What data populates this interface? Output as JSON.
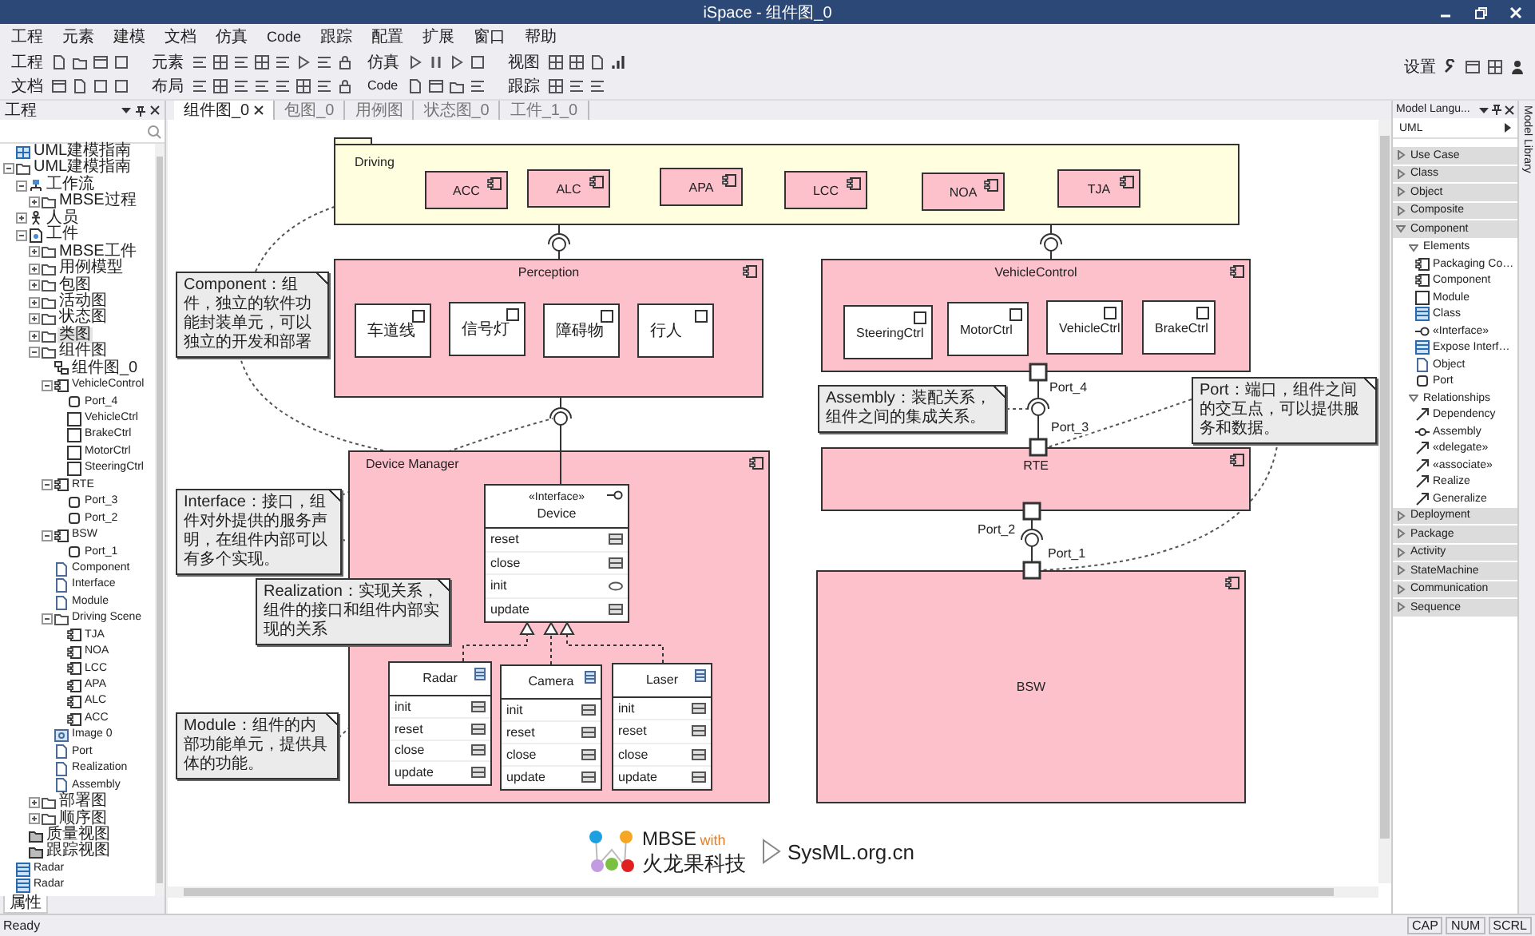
{
  "window": {
    "title": "iSpace - 组件图_0"
  },
  "menu": [
    "工程",
    "元素",
    "建模",
    "文档",
    "仿真",
    "Code",
    "跟踪",
    "配置",
    "扩展",
    "窗口",
    "帮助"
  ],
  "toolbar": {
    "columns": [
      [
        "工程",
        "文档"
      ],
      [
        "元素",
        "布局"
      ],
      [
        "仿真",
        "Code"
      ],
      [
        "视图",
        "跟踪"
      ]
    ],
    "settings": "设置"
  },
  "project_panel": {
    "title": "工程",
    "bottom_tab": "属性",
    "tree": [
      {
        "label": "UML建模指南",
        "kind": "model",
        "selected": false
      },
      {
        "label": "UML建模指南",
        "kind": "folder",
        "expanded": true,
        "selected": false,
        "children": [
          {
            "label": "工作流",
            "kind": "workflow",
            "expanded": true,
            "selected": false,
            "children": [
              {
                "label": "MBSE过程",
                "kind": "folder",
                "expanded": false,
                "selected": false
              }
            ]
          },
          {
            "label": "人员",
            "kind": "actor",
            "expanded": false,
            "selected": false
          },
          {
            "label": "工件",
            "kind": "artifact",
            "expanded": true,
            "selected": false,
            "children": [
              {
                "label": "MBSE工件",
                "kind": "folder",
                "expanded": false,
                "selected": false
              },
              {
                "label": "用例模型",
                "kind": "folder",
                "expanded": false,
                "selected": false
              },
              {
                "label": "包图",
                "kind": "folder",
                "expanded": false,
                "selected": false
              },
              {
                "label": "活动图",
                "kind": "folder",
                "expanded": false,
                "selected": false
              },
              {
                "label": "状态图",
                "kind": "folder",
                "expanded": false,
                "selected": false
              },
              {
                "label": "类图",
                "kind": "folder",
                "expanded": false,
                "selected": true
              },
              {
                "label": "组件图",
                "kind": "folder",
                "expanded": true,
                "selected": false,
                "children": [
                  {
                    "label": "组件图_0",
                    "kind": "diagram",
                    "selected": false
                  },
                  {
                    "label": "VehicleControl",
                    "kind": "component",
                    "expanded": true,
                    "selected": false,
                    "children": [
                      {
                        "label": "Port_4",
                        "kind": "port",
                        "selected": false
                      },
                      {
                        "label": "VehicleCtrl",
                        "kind": "module",
                        "selected": false
                      },
                      {
                        "label": "BrakeCtrl",
                        "kind": "module",
                        "selected": false
                      },
                      {
                        "label": "MotorCtrl",
                        "kind": "module",
                        "selected": false
                      },
                      {
                        "label": "SteeringCtrl",
                        "kind": "module",
                        "selected": false
                      }
                    ]
                  },
                  {
                    "label": "RTE",
                    "kind": "component",
                    "expanded": true,
                    "selected": false,
                    "children": [
                      {
                        "label": "Port_3",
                        "kind": "port",
                        "selected": false
                      },
                      {
                        "label": "Port_2",
                        "kind": "port",
                        "selected": false
                      }
                    ]
                  },
                  {
                    "label": "BSW",
                    "kind": "component",
                    "expanded": true,
                    "selected": false,
                    "children": [
                      {
                        "label": "Port_1",
                        "kind": "port",
                        "selected": false
                      }
                    ]
                  },
                  {
                    "label": "Component",
                    "kind": "document",
                    "selected": false
                  },
                  {
                    "label": "Interface",
                    "kind": "document",
                    "selected": false
                  },
                  {
                    "label": "Module",
                    "kind": "document",
                    "selected": false
                  },
                  {
                    "label": "Driving Scene",
                    "kind": "folder",
                    "expanded": true,
                    "selected": false,
                    "children": [
                      {
                        "label": "TJA",
                        "kind": "component",
                        "selected": false
                      },
                      {
                        "label": "NOA",
                        "kind": "component",
                        "selected": false
                      },
                      {
                        "label": "LCC",
                        "kind": "component",
                        "selected": false
                      },
                      {
                        "label": "APA",
                        "kind": "component",
                        "selected": false
                      },
                      {
                        "label": "ALC",
                        "kind": "component",
                        "selected": false
                      },
                      {
                        "label": "ACC",
                        "kind": "component",
                        "selected": false
                      }
                    ]
                  },
                  {
                    "label": "Image 0",
                    "kind": "image",
                    "selected": false
                  },
                  {
                    "label": "Port",
                    "kind": "document",
                    "selected": false
                  },
                  {
                    "label": "Realization",
                    "kind": "document",
                    "selected": false
                  },
                  {
                    "label": "Assembly",
                    "kind": "document",
                    "selected": false
                  }
                ]
              },
              {
                "label": "部署图",
                "kind": "folder",
                "expanded": false,
                "selected": false
              },
              {
                "label": "顺序图",
                "kind": "folder",
                "expanded": false,
                "selected": false
              }
            ]
          },
          {
            "label": "质量视图",
            "kind": "view",
            "selected": false
          },
          {
            "label": "跟踪视图",
            "kind": "view",
            "selected": false
          }
        ]
      },
      {
        "label": "Radar",
        "kind": "class",
        "selected": false
      },
      {
        "label": "Radar",
        "kind": "class",
        "selected": false
      }
    ]
  },
  "doc_tabs": [
    {
      "label": "组件图_0",
      "selected": true
    },
    {
      "label": "包图_0",
      "selected": false
    },
    {
      "label": "用例图",
      "selected": false
    },
    {
      "label": "状态图_0",
      "selected": false
    },
    {
      "label": "工件_1_0",
      "selected": false
    }
  ],
  "diagram": {
    "package": {
      "name": "Driving",
      "components": [
        "ACC",
        "ALC",
        "APA",
        "LCC",
        "NOA",
        "TJA"
      ]
    },
    "components": [
      {
        "name": "Perception",
        "parts": [
          "车道线",
          "信号灯",
          "障碍物",
          "行人"
        ]
      },
      {
        "name": "VehicleControl",
        "parts": [
          "SteeringCtrl",
          "MotorCtrl",
          "VehicleCtrl",
          "BrakeCtrl"
        ]
      },
      {
        "name": "Device Manager"
      },
      {
        "name": "RTE"
      },
      {
        "name": "BSW"
      }
    ],
    "interface": {
      "stereotype": "«Interface»",
      "name": "Device",
      "operations": [
        {
          "name": "reset",
          "kind": "operation"
        },
        {
          "name": "close",
          "kind": "operation"
        },
        {
          "name": "init",
          "kind": "reception"
        },
        {
          "name": "update",
          "kind": "operation"
        }
      ]
    },
    "classes": [
      {
        "name": "Radar",
        "operations": [
          "init",
          "reset",
          "close",
          "update"
        ]
      },
      {
        "name": "Camera",
        "operations": [
          "init",
          "reset",
          "close",
          "update"
        ]
      },
      {
        "name": "Laser",
        "operations": [
          "init",
          "reset",
          "close",
          "update"
        ]
      }
    ],
    "ports": [
      "Port_4",
      "Port_3",
      "Port_2",
      "Port_1"
    ],
    "notes": [
      "Component：组件，独立的软件功能封装单元，可以独立的开发和部署",
      "Interface：接口，组件对外提供的服务声明，在组件内部可以有多个实现。",
      "Realization：实现关系，组件的接口和组件内部实现的关系",
      "Module：组件的内部功能单元，提供具体的功能。",
      "Assembly：装配关系，组件之间的集成关系。",
      "Port：端口，组件之间的交互点，可以提供服务和数据。"
    ]
  },
  "logo": {
    "brand": "MBSE",
    "with": "with",
    "company": "火龙果科技",
    "site": "SysML.org.cn"
  },
  "palette": {
    "title": "Model Langu...",
    "profile": "UML",
    "side_tab": "Model Library",
    "items": [
      {
        "label": "Use Case",
        "kind": "category",
        "expanded": false
      },
      {
        "label": "Class",
        "kind": "category",
        "expanded": false
      },
      {
        "label": "Object",
        "kind": "category",
        "expanded": false
      },
      {
        "label": "Composite",
        "kind": "category",
        "expanded": false
      },
      {
        "label": "Component",
        "kind": "category",
        "expanded": true,
        "children": [
          {
            "label": "Elements",
            "kind": "group",
            "expanded": true,
            "children": [
              {
                "label": "Packaging Co…",
                "kind": "tool"
              },
              {
                "label": "Component",
                "kind": "tool"
              },
              {
                "label": "Module",
                "kind": "tool"
              },
              {
                "label": "Class",
                "kind": "tool"
              },
              {
                "label": "«Interface»",
                "kind": "tool"
              },
              {
                "label": "Expose Interf…",
                "kind": "tool"
              },
              {
                "label": "Object",
                "kind": "tool"
              },
              {
                "label": "Port",
                "kind": "tool"
              }
            ]
          },
          {
            "label": "Relationships",
            "kind": "group",
            "expanded": true,
            "children": [
              {
                "label": "Dependency",
                "kind": "tool"
              },
              {
                "label": "Assembly",
                "kind": "tool"
              },
              {
                "label": "«delegate»",
                "kind": "tool"
              },
              {
                "label": "«associate»",
                "kind": "tool"
              },
              {
                "label": "Realize",
                "kind": "tool"
              },
              {
                "label": "Generalize",
                "kind": "tool"
              }
            ]
          }
        ]
      },
      {
        "label": "Deployment",
        "kind": "category",
        "expanded": false
      },
      {
        "label": "Package",
        "kind": "category",
        "expanded": false
      },
      {
        "label": "Activity",
        "kind": "category",
        "expanded": false
      },
      {
        "label": "StateMachine",
        "kind": "category",
        "expanded": false
      },
      {
        "label": "Communication",
        "kind": "category",
        "expanded": false
      },
      {
        "label": "Sequence",
        "kind": "category",
        "expanded": false
      }
    ]
  },
  "status_bar": {
    "text": "Ready",
    "indicators": [
      "CAP",
      "NUM",
      "SCRL"
    ]
  }
}
